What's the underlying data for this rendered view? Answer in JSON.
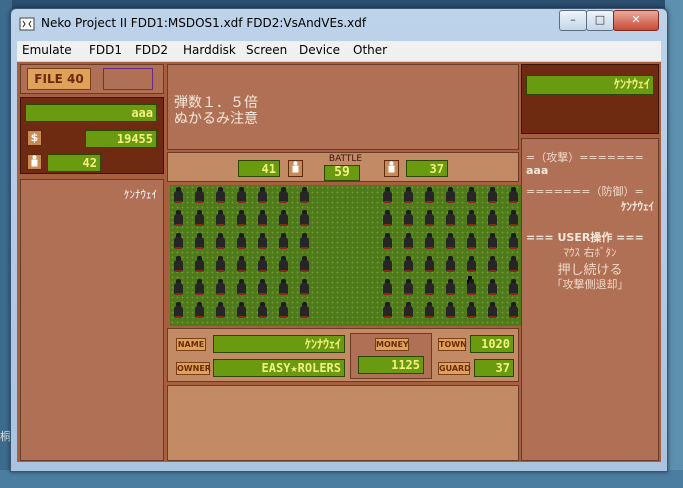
{
  "window": {
    "title": "Neko Project II  FDD1:MSDOS1.xdf  FDD2:VsAndVEs.xdf",
    "min_glyph": "–",
    "max_glyph": "□",
    "close_glyph": "✕"
  },
  "menu": [
    "Emulate",
    "FDD1",
    "FDD2",
    "Harddisk",
    "Screen",
    "Device",
    "Other"
  ],
  "left_panel": {
    "file_button": "FILE 40",
    "player_name": "aaa",
    "money_icon": "$",
    "money": "19455",
    "troops": "42",
    "list_entry": "ｹﾝﾅｳｪｲ"
  },
  "message": {
    "line1": "弾数１．５倍",
    "line2": "ぬかるみ注意"
  },
  "battle": {
    "left_count": "41",
    "label": "BATTLE",
    "turn": "59",
    "right_count": "37"
  },
  "right_panel": {
    "enemy_name": "ｹﾝﾅｳｪｲ",
    "attack_header": "=（攻撃）=======",
    "attack_name": "aaa",
    "defense_header": "=======（防御）=",
    "defense_name": "ｹﾝﾅｳｪｲ",
    "user_header": "=== USER操作 ===",
    "hint1": "ﾏｳｽ 右ﾎﾞﾀﾝ",
    "hint2": "押し続ける",
    "hint3": "「攻撃側退却」"
  },
  "info": {
    "name_tag": "NAME",
    "name": "ｹﾝﾅｳｪｲ",
    "owner_tag": "OWNER",
    "owner": "EASY★ROLERS",
    "money_tag": "MONEY",
    "money": "1125",
    "town_tag": "TOWN",
    "town": "1020",
    "guard_tag": "GUARD",
    "guard": "37"
  },
  "desktop_glyph": "桐"
}
